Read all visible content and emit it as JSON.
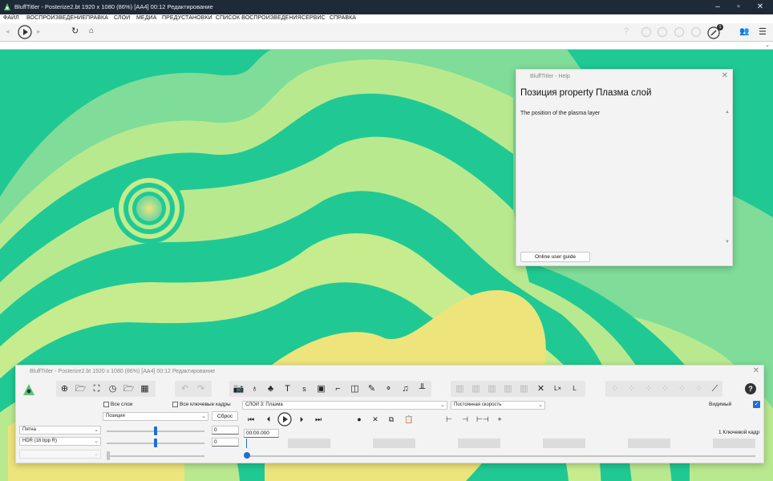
{
  "window": {
    "title": "BluffTitler - Posterize2.bt 1920 x 1080 (86%) [AA4] 00:12 Редактирование"
  },
  "menu": [
    "ФАЙЛ",
    "ВОСПРОИЗВЕДЕНИЕ",
    "ПРАВКА",
    "СЛОИ",
    "МЕДИА",
    "ПРЕДУСТАНОВКИ",
    "СПИСОК ВОСПРОИЗВЕДЕНИЯ",
    "СЕРВИС",
    "СПРАВКА"
  ],
  "toolbar": {
    "badge": "1"
  },
  "help": {
    "title": "BluffTitler - Help",
    "heading": "Позиция property Плазма слой",
    "body": "The position of the plasma layer",
    "button": "Online user guide"
  },
  "panel": {
    "title": "BluffTitler - Posterize2.bt 1920 x 1080 (86%) [AA4] 00:12 Редактирование",
    "all_layers": "Все слои",
    "all_keyframes": "Все ключевые кадры",
    "layer_select": "СЛОЙ 3: Плазма",
    "speed_select": "Постоянная скорость",
    "visible_label": "Видимый",
    "property_select": "Позиция",
    "reset_button": "Сброс",
    "style_select": "Пятна",
    "format_select": "HDR (16 bpp R)",
    "empty_select": "",
    "value1": "0",
    "value2": "0",
    "time": "00:00.000",
    "keyframes": "1 Ключевой кадр",
    "slider1_level": 0.5,
    "slider2_level": 0.5,
    "slider3_level": 0.0
  },
  "colors": {
    "canvas_base": "#20c993",
    "canvas_light": "#c6ec8e",
    "canvas_yellow": "#eee47c",
    "accent": "#1e6fd0",
    "titlebar": "#1f2a38"
  }
}
